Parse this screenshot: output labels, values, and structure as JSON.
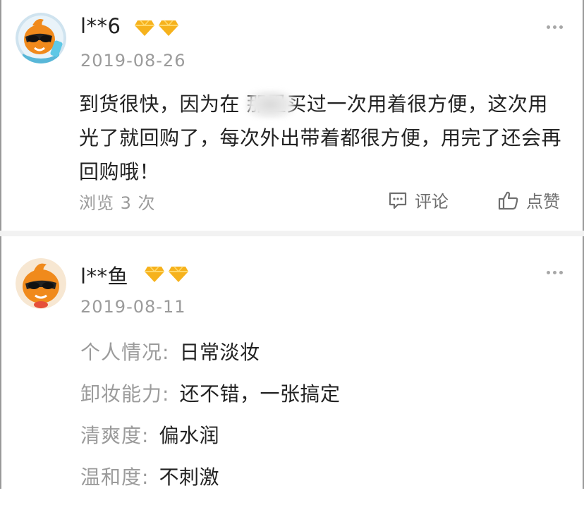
{
  "reviews": [
    {
      "username": "l**6",
      "badge_count": 2,
      "date": "2019-08-26",
      "content": "到货很快，因为在 那里买过一次用着很方便，这次用光了就回购了，每次外出带着都很方便，用完了还会再回购哦！",
      "views": "浏览 3 次",
      "comment_label": "评论",
      "like_label": "点赞"
    },
    {
      "username": "l**鱼",
      "badge_count": 2,
      "date": "2019-08-11",
      "details": [
        {
          "key": "个人情况:",
          "value": "日常淡妆"
        },
        {
          "key": "卸妆能力:",
          "value": "还不错，一张搞定"
        },
        {
          "key": "清爽度:",
          "value": "偏水润"
        },
        {
          "key": "温和度:",
          "value": "不刺激"
        }
      ]
    }
  ],
  "icons": {
    "avatar": "mascot-avatar",
    "badge": "diamond-icon",
    "more": "more-dots-icon",
    "comment": "comment-icon",
    "like": "thumbs-up-icon"
  },
  "colors": {
    "badge": "#f6b21c",
    "muted": "#9b9b9b",
    "text": "#222222",
    "avatar_bg": "#f08a1c"
  }
}
